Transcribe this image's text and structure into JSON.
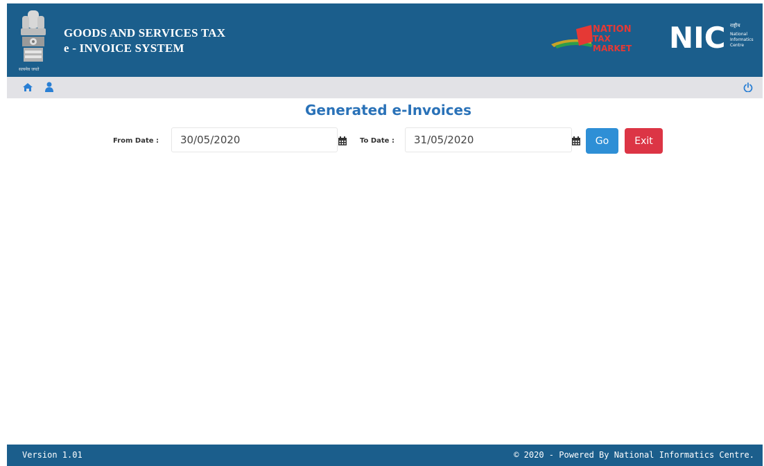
{
  "header": {
    "title_line1": "GOODS AND SERVICES TAX",
    "title_line2": "e - INVOICE SYSTEM",
    "emblem_caption": "सत्यमेव जयते",
    "ntm_logo_text": [
      "NATION",
      "TAX",
      "MARKET"
    ],
    "nic_logo_text": "NIC",
    "nic_logo_subtext": [
      "राष्ट्रीय",
      "National",
      "Informatics",
      "Centre"
    ],
    "colors": {
      "header_bg": "#1b5e8c",
      "nav_bg": "#e2e2e6"
    }
  },
  "navbar": {
    "icons": [
      "home-icon",
      "user-icon",
      "power-icon"
    ],
    "icon_color": "#2a7fd4"
  },
  "main": {
    "page_title": "Generated e-Invoices",
    "from_label": "From Date :",
    "from_value": "30/05/2020",
    "to_label": "To Date :",
    "to_value": "31/05/2020",
    "go_label": "Go",
    "exit_label": "Exit",
    "colors": {
      "title": "#2a72b8",
      "go": "#2e8fd6",
      "exit": "#dc3545"
    }
  },
  "footer": {
    "version": "Version 1.01",
    "copyright": "© 2020 - Powered By National Informatics Centre."
  }
}
